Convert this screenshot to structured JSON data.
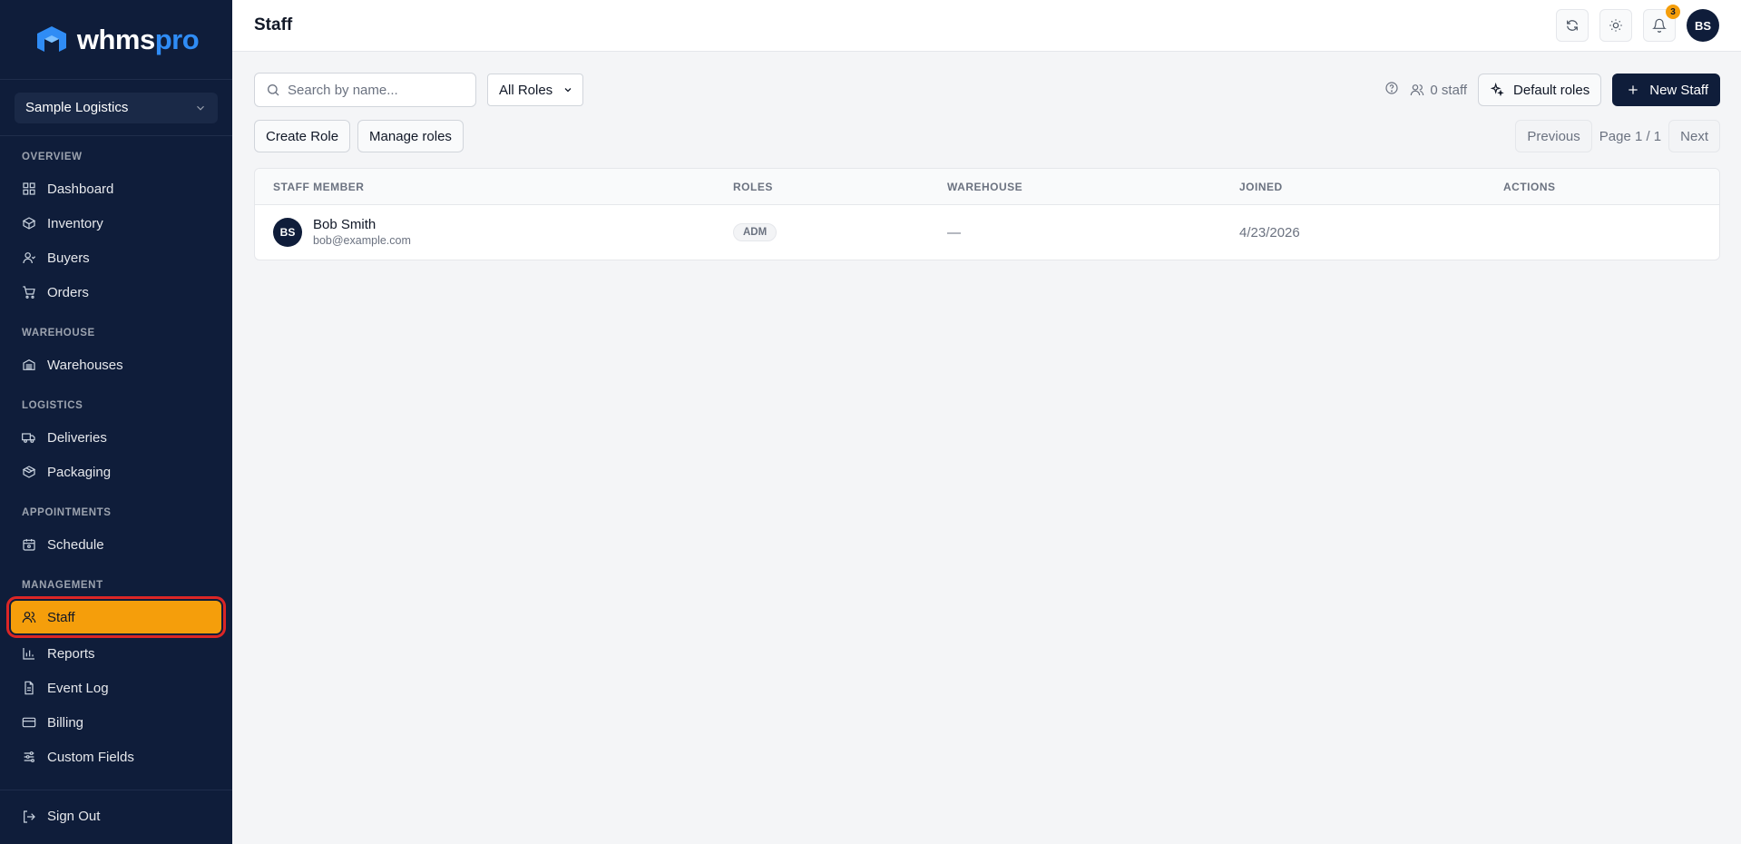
{
  "app": {
    "logo_main": "whms",
    "logo_accent": "pro"
  },
  "org": {
    "name": "Sample Logistics"
  },
  "sidebar": {
    "sections": [
      {
        "title": "OVERVIEW",
        "items": [
          {
            "label": "Dashboard",
            "icon": "dashboard-icon"
          },
          {
            "label": "Inventory",
            "icon": "box-icon"
          },
          {
            "label": "Buyers",
            "icon": "user-icon"
          },
          {
            "label": "Orders",
            "icon": "cart-icon"
          }
        ]
      },
      {
        "title": "WAREHOUSE",
        "items": [
          {
            "label": "Warehouses",
            "icon": "warehouse-icon"
          }
        ]
      },
      {
        "title": "LOGISTICS",
        "items": [
          {
            "label": "Deliveries",
            "icon": "truck-icon"
          },
          {
            "label": "Packaging",
            "icon": "package-icon"
          }
        ]
      },
      {
        "title": "APPOINTMENTS",
        "items": [
          {
            "label": "Schedule",
            "icon": "calendar-icon"
          }
        ]
      },
      {
        "title": "MANAGEMENT",
        "items": [
          {
            "label": "Staff",
            "icon": "users-icon",
            "active": true
          },
          {
            "label": "Reports",
            "icon": "bar-chart-icon"
          },
          {
            "label": "Event Log",
            "icon": "file-icon"
          },
          {
            "label": "Billing",
            "icon": "credit-card-icon"
          },
          {
            "label": "Custom Fields",
            "icon": "sliders-icon"
          }
        ]
      }
    ],
    "sign_out": "Sign Out"
  },
  "header": {
    "title": "Staff",
    "notification_count": "3",
    "user_initials": "BS"
  },
  "toolbar": {
    "search_placeholder": "Search by name...",
    "role_filter": "All Roles",
    "staff_count": "0 staff",
    "default_roles": "Default roles",
    "new_staff": "New Staff",
    "create_role": "Create Role",
    "manage_roles": "Manage roles"
  },
  "pager": {
    "previous": "Previous",
    "page_label": "Page 1 / 1",
    "next": "Next"
  },
  "table": {
    "columns": [
      "STAFF MEMBER",
      "ROLES",
      "WAREHOUSE",
      "JOINED",
      "ACTIONS"
    ],
    "rows": [
      {
        "initials": "BS",
        "name": "Bob Smith",
        "email": "bob@example.com",
        "role": "ADM",
        "warehouse": "—",
        "joined": "4/23/2026"
      }
    ]
  },
  "colors": {
    "sidebar_bg": "#0f1d3a",
    "active_bg": "#f59e0b",
    "highlight_outline": "#dc2626",
    "primary_button": "#0f1d3a",
    "logo_accent": "#2f8cf5"
  }
}
